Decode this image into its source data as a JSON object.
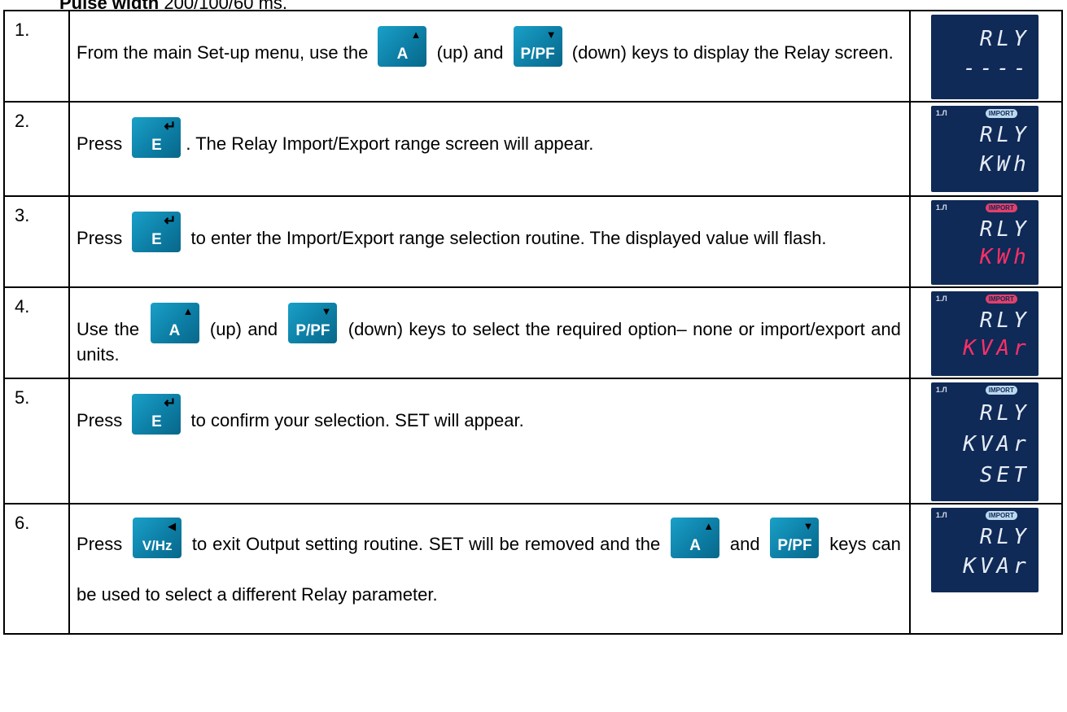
{
  "top_line": {
    "bold": "Pulse width",
    "rest": " 200/100/60 ms."
  },
  "steps": [
    {
      "num": "1.",
      "segments": [
        "From the main Set-up menu, use the ",
        " (up) and ",
        " (down) keys to display the Relay screen."
      ],
      "display": {
        "line1": "RLY",
        "line2": "----"
      }
    },
    {
      "num": "2.",
      "segments": [
        "Press ",
        ".  The Relay Import/Export range screen will appear."
      ],
      "display": {
        "pulse": "1.Л",
        "badge": "IMPORT",
        "line1": "RLY",
        "line2": "KWh"
      }
    },
    {
      "num": "3.",
      "segments": [
        "Press ",
        " to enter the Import/Export range selection routine.  The displayed value will flash."
      ],
      "display": {
        "pulse": "1.Л",
        "badge": "IMPORT",
        "line1": "RLY",
        "line2": "KWh"
      }
    },
    {
      "num": "4.",
      "segments": [
        "Use the ",
        " (up) and ",
        " (down) keys to select the required option– none or import/export and units."
      ],
      "display": {
        "pulse": "1.Л",
        "badge": "IMPORT",
        "line1": "RLY",
        "line2": "KVAr"
      }
    },
    {
      "num": "5.",
      "segments": [
        "Press ",
        " to confirm your selection.  SET will appear."
      ],
      "display": {
        "pulse": "1.Л",
        "badge": "IMPORT",
        "line1": "RLY",
        "line2": "KVAr",
        "line3": "SET"
      }
    },
    {
      "num": "6.",
      "segments": [
        "Press ",
        " to exit Output setting routine.  SET will be removed and the ",
        " and ",
        " keys can be used to select a different Relay parameter."
      ],
      "display": {
        "pulse": "1.Л",
        "badge": "IMPORT",
        "line1": "RLY",
        "line2": "KVAr"
      }
    }
  ],
  "keys": {
    "up": {
      "label": "A",
      "icon": "up-triangle-icon"
    },
    "down": {
      "label": "P/PF",
      "icon": "down-triangle-icon"
    },
    "enter": {
      "label": "E",
      "icon": "enter-arrow-icon"
    },
    "left": {
      "label": "V/Hz",
      "icon": "left-triangle-icon"
    }
  },
  "colors": {
    "key_blue": "#1aa0c8",
    "lcd_bg": "#0f2a57",
    "lcd_text": "#e6ebf4",
    "lcd_flash": "#ff2f67"
  }
}
